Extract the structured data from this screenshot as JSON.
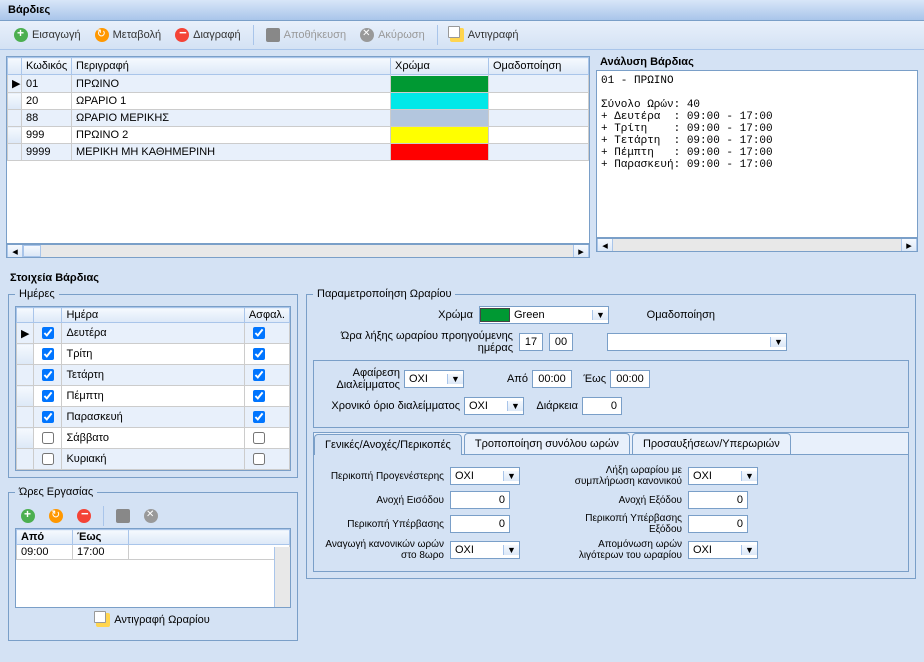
{
  "window_title": "Βάρδιες",
  "toolbar": {
    "insert": "Εισαγωγή",
    "modify": "Μεταβολή",
    "delete": "Διαγραφή",
    "save": "Αποθήκευση",
    "cancel": "Ακύρωση",
    "copy": "Αντιγραφή"
  },
  "grid": {
    "headers": {
      "code": "Κωδικός",
      "desc": "Περιγραφή",
      "color": "Χρώμα",
      "group": "Ομαδοποίηση"
    },
    "rows": [
      {
        "code": "01",
        "desc": "ΠΡΩΙΝΟ",
        "color": "#009933",
        "selected": true
      },
      {
        "code": "20",
        "desc": "ΩΡΑΡΙΟ 1",
        "color": "#00e8e8"
      },
      {
        "code": "88",
        "desc": "ΩΡΑΡΙΟ ΜΕΡΙΚΗΣ",
        "color": "#b3c6de"
      },
      {
        "code": "999",
        "desc": "ΠΡΩΙΝΟ 2",
        "color": "#ffff00"
      },
      {
        "code": "9999",
        "desc": "ΜΕΡΙΚΗ ΜΗ ΚΑΘΗΜΕΡΙΝΗ",
        "color": "#ff0000"
      }
    ]
  },
  "analysis": {
    "title": "Ανάλυση Βάρδιας",
    "text": "01 - ΠΡΩΙΝΟ\n\nΣύνολο Ωρών: 40\n+ Δευτέρα  : 09:00 - 17:00\n+ Τρίτη    : 09:00 - 17:00\n+ Τετάρτη  : 09:00 - 17:00\n+ Πέμπτη   : 09:00 - 17:00\n+ Παρασκευή: 09:00 - 17:00"
  },
  "details_label": "Στοιχεία Βάρδιας",
  "days": {
    "legend": "Ημέρες",
    "headers": {
      "day": "Ημέρα",
      "insur": "Ασφαλ."
    },
    "rows": [
      {
        "name": "Δευτέρα",
        "enabled": true,
        "insur": true,
        "sel": true
      },
      {
        "name": "Τρίτη",
        "enabled": true,
        "insur": true
      },
      {
        "name": "Τετάρτη",
        "enabled": true,
        "insur": true
      },
      {
        "name": "Πέμπτη",
        "enabled": true,
        "insur": true
      },
      {
        "name": "Παρασκευή",
        "enabled": true,
        "insur": true
      },
      {
        "name": "Σάββατο",
        "enabled": false,
        "insur": false
      },
      {
        "name": "Κυριακή",
        "enabled": false,
        "insur": false
      }
    ]
  },
  "hours": {
    "legend": "Ώρες Εργασίας",
    "headers": {
      "from": "Από",
      "to": "Έως"
    },
    "rows": [
      {
        "from": "09:00",
        "to": "17:00"
      }
    ],
    "copy_btn": "Αντιγραφή Ωραρίου"
  },
  "schedule": {
    "legend": "Παραμετροποίηση Ωραρίου",
    "color_label": "Χρώμα",
    "color_value": "Green",
    "color_hex": "#009933",
    "prev_day_end_label": "Ώρα λήξης ωραρίου προηγούμενης ημέρας",
    "prev_day_end_h": "17",
    "prev_day_end_m": "00",
    "group_label": "Ομαδοποίηση",
    "group_value": "",
    "break_sub_label": "Αφαίρεση Διαλείμματος",
    "break_sub_val": "ΟΧΙ",
    "from_label": "Από",
    "from_val": "00:00",
    "to_label": "Έως",
    "to_val": "00:00",
    "break_limit_label": "Χρονικό όριο διαλείμματος",
    "break_limit_val": "ΟΧΙ",
    "duration_label": "Διάρκεια",
    "duration_val": "0"
  },
  "tabs": {
    "t1": "Γενικές/Ανοχές/Περικοπές",
    "t2": "Τροποποίηση συνόλου ωρών",
    "t3": "Προσαυξήσεων/Υπερωριών"
  },
  "tab1": {
    "cut_earlier": "Περικοπή Προγενέστερης",
    "cut_earlier_val": "ΟΧΙ",
    "end_fill": "Λήξη ωραρίου με συμπλήρωση κανονικού",
    "end_fill_val": "ΟΧΙ",
    "tol_in": "Ανοχή Εισόδου",
    "tol_in_val": "0",
    "tol_out": "Ανοχή Εξόδου",
    "tol_out_val": "0",
    "cut_over": "Περικοπή Υπέρβασης",
    "cut_over_val": "0",
    "cut_over_exit": "Περικοπή Υπέρβασης Εξόδου",
    "cut_over_exit_val": "0",
    "reduce_normal": "Αναγωγή κανονικών ωρών στο 8ωρο",
    "reduce_normal_val": "ΟΧΙ",
    "isolate_less": "Απομόνωση ωρών λιγότερων του ωραρίου",
    "isolate_less_val": "ΟΧΙ"
  }
}
